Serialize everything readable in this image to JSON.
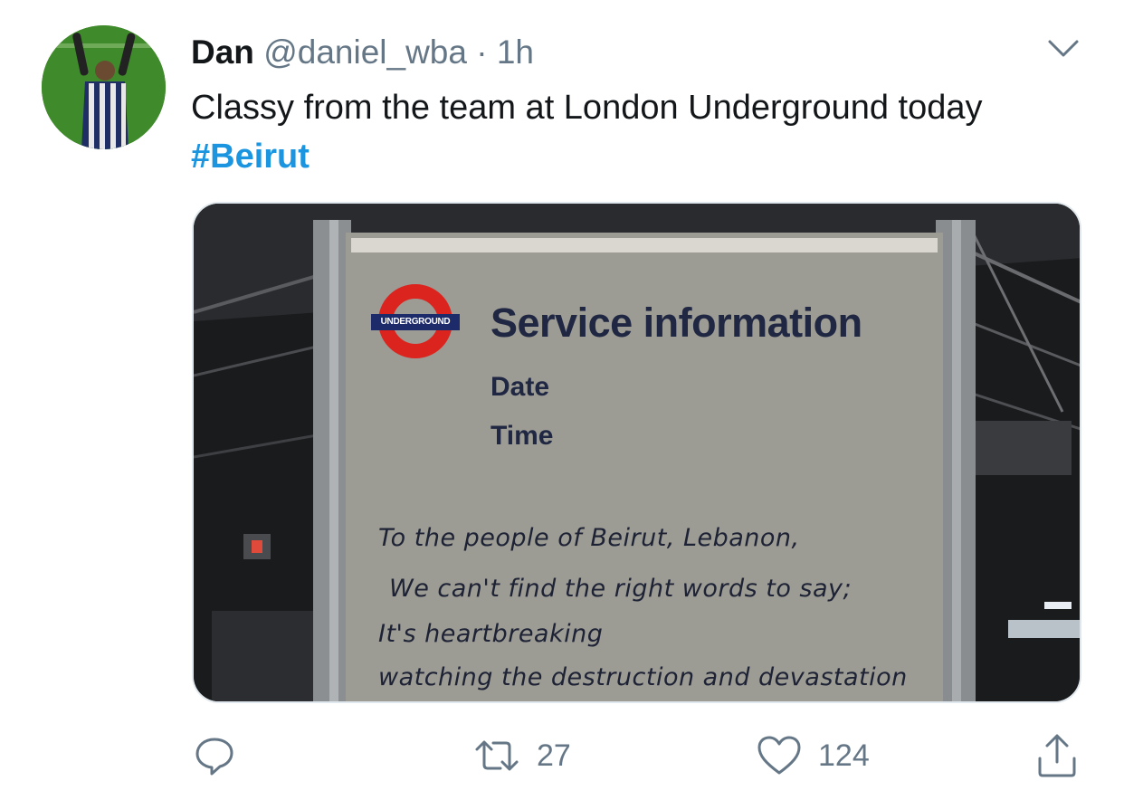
{
  "tweet": {
    "author_name": "Dan",
    "handle": "@daniel_wba",
    "separator": "·",
    "time": "1h",
    "text": "Classy from the team at London Underground today",
    "hashtag": "#Beirut"
  },
  "media": {
    "roundel_text": "UNDERGROUND",
    "sign_title": "Service information",
    "date_label": "Date",
    "time_label": "Time",
    "handwritten_lines": [
      "To the people of Beirut, Lebanon,",
      "We can't find the right words to say;",
      "It's heartbreaking",
      "watching the destruction and devastation"
    ]
  },
  "actions": {
    "reply_icon": "reply-icon",
    "retweet_icon": "retweet-icon",
    "retweet_count": "27",
    "like_icon": "heart-icon",
    "like_count": "124",
    "share_icon": "share-icon"
  },
  "colors": {
    "hashtag": "#1b95e0",
    "secondary_text": "#657786",
    "roundel_red": "#dc241f",
    "roundel_blue": "#1d2b6b"
  }
}
